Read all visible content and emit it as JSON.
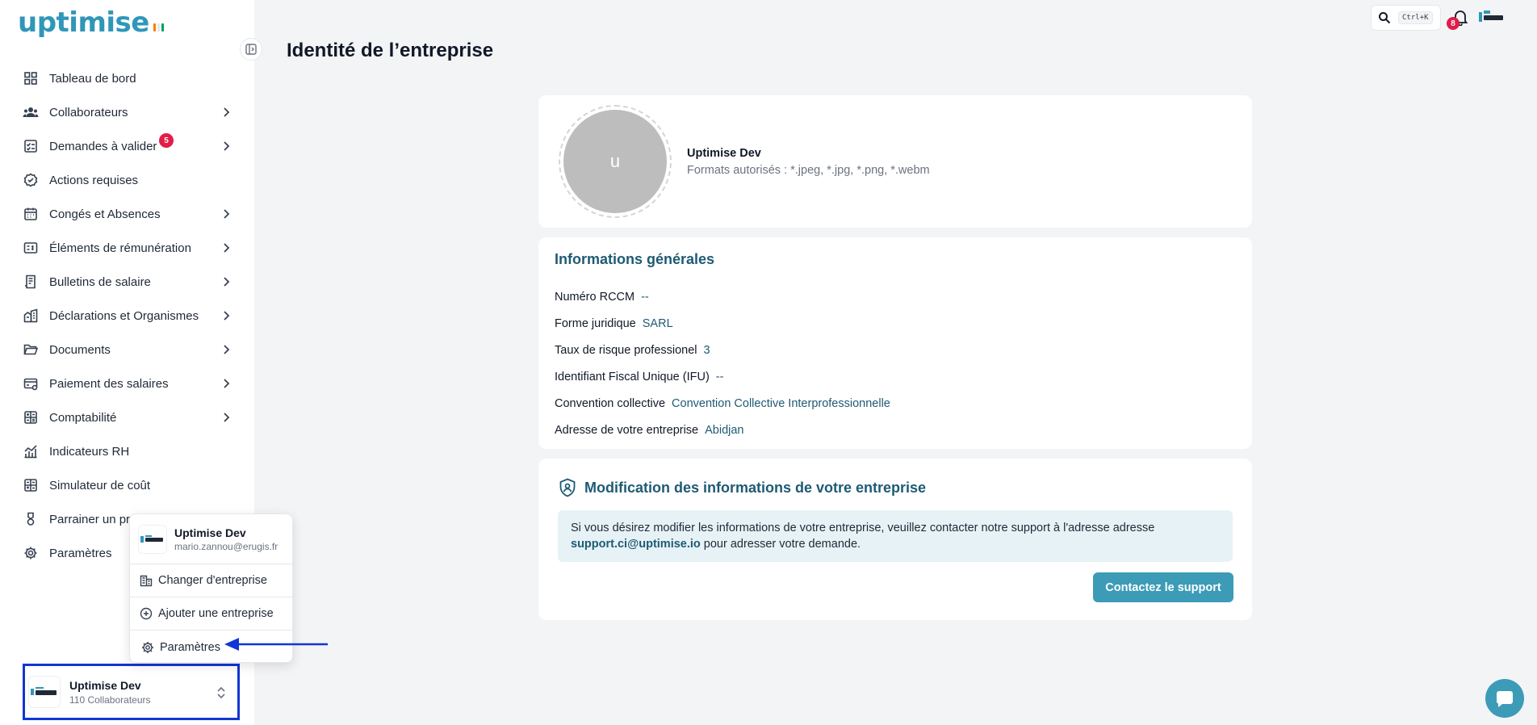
{
  "logo": {
    "text": "uptimise",
    "flag_colors": [
      "#f77f00",
      "#ffffff",
      "#009e60"
    ]
  },
  "sidebar": {
    "items": [
      {
        "label": "Tableau de bord",
        "icon": "dashboard-icon",
        "has_submenu": false
      },
      {
        "label": "Collaborateurs",
        "icon": "users-icon",
        "has_submenu": true
      },
      {
        "label": "Demandes à valider",
        "icon": "checklist-icon",
        "has_submenu": true,
        "badge": "5"
      },
      {
        "label": "Actions requises",
        "icon": "badge-check-icon",
        "has_submenu": false
      },
      {
        "label": "Congés et Absences",
        "icon": "calendar-icon",
        "has_submenu": true
      },
      {
        "label": "Éléments de rémunération",
        "icon": "salary-icon",
        "has_submenu": true
      },
      {
        "label": "Bulletins de salaire",
        "icon": "payslip-icon",
        "has_submenu": true
      },
      {
        "label": "Déclarations et Organismes",
        "icon": "building-icon",
        "has_submenu": true
      },
      {
        "label": "Documents",
        "icon": "folder-icon",
        "has_submenu": true
      },
      {
        "label": "Paiement des salaires",
        "icon": "card-icon",
        "has_submenu": true
      },
      {
        "label": "Comptabilité",
        "icon": "calculator-icon",
        "has_submenu": true
      },
      {
        "label": "Indicateurs RH",
        "icon": "chart-icon",
        "has_submenu": false
      },
      {
        "label": "Simulateur de coût",
        "icon": "simulator-icon",
        "has_submenu": false
      },
      {
        "label": "Parrainer un pr",
        "icon": "medal-icon",
        "has_submenu": false
      },
      {
        "label": "Paramètres",
        "icon": "gear-icon",
        "has_submenu": false
      }
    ]
  },
  "popup": {
    "name": "Uptimise Dev",
    "email": "mario.zannou@erugis.fr",
    "items": [
      {
        "label": "Changer d'entreprise",
        "icon": "building-icon"
      },
      {
        "label": "Ajouter une entreprise",
        "icon": "plus-circle-icon"
      },
      {
        "label": "Paramètres",
        "icon": "gear-icon"
      }
    ]
  },
  "company": {
    "name": "Uptimise Dev",
    "subtitle": "110 Collaborateurs"
  },
  "topbar": {
    "shortcut": "Ctrl+K",
    "notifications_count": "8"
  },
  "page": {
    "title": "Identité de l’entreprise"
  },
  "profile": {
    "initial": "u",
    "name": "Uptimise Dev",
    "formats": "Formats autorisés : *.jpeg, *.jpg, *.png, *.webm"
  },
  "general_info": {
    "title": "Informations générales",
    "rows": [
      {
        "label": "Numéro RCCM",
        "value": "--"
      },
      {
        "label": "Forme juridique",
        "value": "SARL"
      },
      {
        "label": "Taux de risque professionel",
        "value": "3"
      },
      {
        "label": "Identifiant Fiscal Unique (IFU)",
        "value": "--"
      },
      {
        "label": "Convention collective",
        "value": "Convention Collective Interprofessionnelle"
      },
      {
        "label": "Adresse de votre entreprise",
        "value": "Abidjan"
      }
    ]
  },
  "edit_section": {
    "title": "Modification des informations de votre entreprise",
    "notice_part1": "Si vous désirez modifier les informations de votre entreprise, veuillez contacter notre support à l'adresse adresse",
    "notice_email": "support.ci@uptimise.io",
    "notice_part2": " pour adresser votre demande.",
    "button_label": "Contactez le support"
  },
  "colors": {
    "accent": "#3c9bb6",
    "heading": "#1e5a74",
    "badge": "#e11d48",
    "annotation": "#1136d4"
  }
}
